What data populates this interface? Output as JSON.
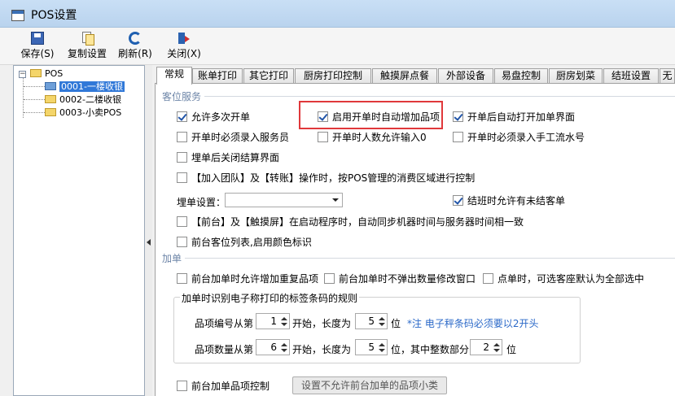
{
  "window": {
    "title": "POS设置"
  },
  "toolbar": {
    "save": "保存(S)",
    "copy": "复制设置",
    "refresh": "刷新(R)",
    "close": "关闭(X)"
  },
  "tree": {
    "root": "POS",
    "items": [
      "0001-一楼收银",
      "0002-二楼收银",
      "0003-小卖POS"
    ]
  },
  "tabs": [
    "常规",
    "账单打印",
    "其它打印",
    "厨房打印控制",
    "触摸屏点餐",
    "外部设备",
    "易盘控制",
    "厨房划菜",
    "结班设置",
    "无"
  ],
  "guest": {
    "section": "客位服务",
    "allow_multi": "允许多次开单",
    "auto_add_items": "启用开单时自动增加品项",
    "auto_open_add": "开单后自动打开加单界面",
    "require_server": "开单时必须录入服务员",
    "allow_zero_guests": "开单时人数允许输入0",
    "require_manual_no": "开单时必须录入手工流水号",
    "close_after_bill": "埋单后关闭结算界面",
    "team_transfer_control": "【加入团队】及【转账】操作时，按POS管理的消费区域进行控制",
    "bill_setting_label": "埋单设置：",
    "bill_setting_value": "",
    "shift_allow_open": "结班时允许有未结客单",
    "sync_time": "【前台】及【触摸屏】在启动程序时，自动同步机器时间与服务器时间相一致",
    "color_list": "前台客位列表,启用颜色标识"
  },
  "add": {
    "section": "加单",
    "allow_duplicate": "前台加单时允许增加重复品项",
    "no_qty_popup": "前台加单时不弹出数量修改窗口",
    "default_all_seats": "点单时，可选客座默认为全部选中",
    "barcode_group": "加单时识别电子称打印的标签条码的规则",
    "item_no_from": "品项编号从第",
    "item_no_start": "1",
    "begin_len": "开始，长度为",
    "item_no_len": "5",
    "unit_pos": "位",
    "note": "*注 电子秤条码必须要以2开头",
    "qty_from": "品项数量从第",
    "qty_start": "6",
    "begin_len2": "开始，长度为",
    "qty_len": "5",
    "int_part": "位，其中整数部分",
    "qty_int": "2",
    "unit_pos2": "位",
    "front_item_control": "前台加单品项控制",
    "set_disallowed_btn": "设置不允许前台加单的品项小类"
  },
  "colors": {
    "highlight": "#e0383b",
    "note": "#2a68c8",
    "section": "#6e86a8",
    "selection": "#3078d8"
  }
}
